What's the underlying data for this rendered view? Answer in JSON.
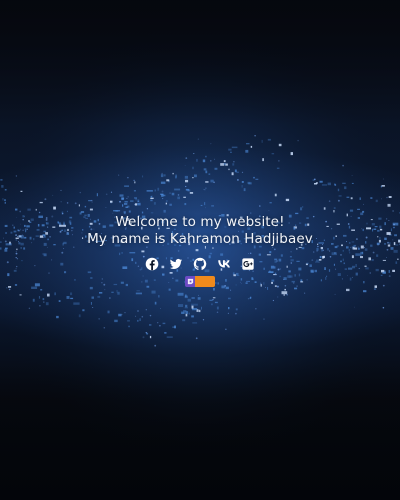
{
  "hero": {
    "line1": "Welcome to my website!",
    "line2": "My name is Kahramon Hadjibaev"
  },
  "socials": [
    {
      "icon": "facebook-icon"
    },
    {
      "icon": "twitter-icon"
    },
    {
      "icon": "github-icon"
    },
    {
      "icon": "vk-icon"
    },
    {
      "icon": "google-plus-icon"
    }
  ],
  "badge": {
    "left_color": "#6d4bc4",
    "right_color": "#f08a1c"
  },
  "colors": {
    "text": "#f2f4f8",
    "background_dark": "#05070d",
    "particle_blue": "#4f8fe0"
  }
}
